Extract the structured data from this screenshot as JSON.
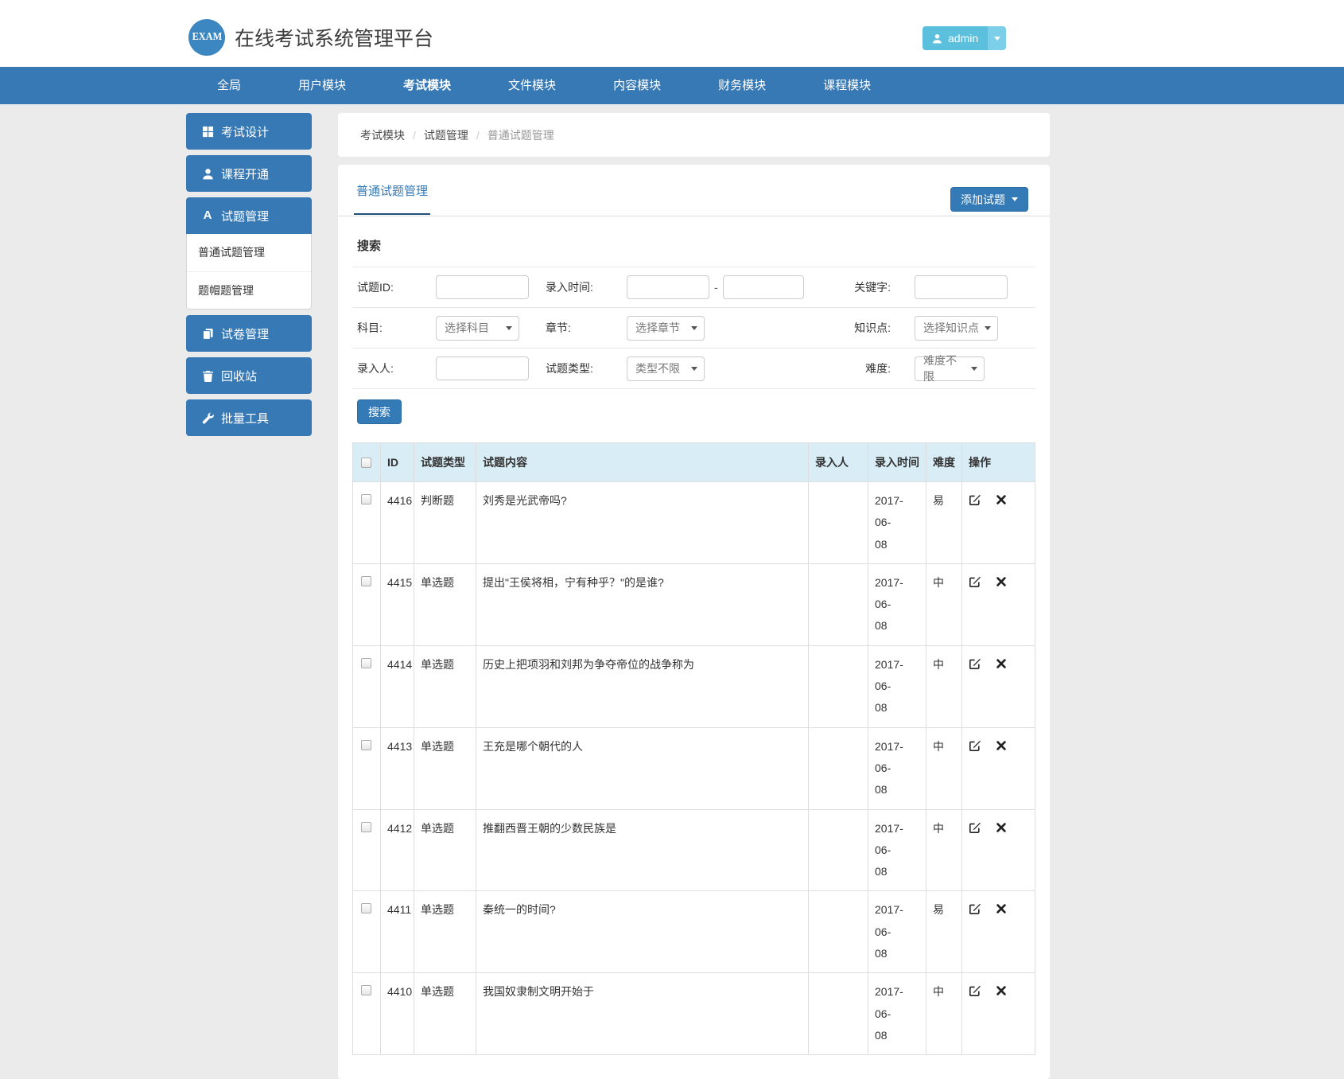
{
  "header": {
    "logo_text": "EXAM",
    "title": "在线考试系统管理平台",
    "user_button": {
      "label": "admin"
    }
  },
  "navbar": {
    "active_index": 2,
    "items": [
      {
        "label": "全局"
      },
      {
        "label": "用户模块"
      },
      {
        "label": "考试模块"
      },
      {
        "label": "文件模块"
      },
      {
        "label": "内容模块"
      },
      {
        "label": "财务模块"
      },
      {
        "label": "课程模块"
      }
    ]
  },
  "sidebar": {
    "items": [
      {
        "label": "考试设计",
        "icon": "grid-icon"
      },
      {
        "label": "课程开通",
        "icon": "user-icon"
      },
      {
        "label": "试题管理",
        "icon": "font-a-icon",
        "icon_glyph": "A",
        "active": true,
        "children": [
          {
            "label": "普通试题管理",
            "active": true
          },
          {
            "label": "题帽题管理",
            "active": false
          }
        ]
      },
      {
        "label": "试卷管理",
        "icon": "files-icon"
      },
      {
        "label": "回收站",
        "icon": "trash-icon"
      },
      {
        "label": "批量工具",
        "icon": "wrench-icon"
      }
    ]
  },
  "breadcrumb": {
    "separator": "/",
    "items": [
      "考试模块",
      "试题管理",
      "普通试题管理"
    ]
  },
  "panel": {
    "active_tab": "普通试题管理",
    "add_button_label": "添加试题",
    "search_heading": "搜索",
    "search_button_label": "搜索"
  },
  "search_form": {
    "row1": {
      "f1_label": "试题ID:",
      "f2_label": "录入时间:",
      "range_separator": "-",
      "f3_label": "关键字:"
    },
    "row2": {
      "f1_label": "科目:",
      "f1_value": "选择科目",
      "f2_label": "章节:",
      "f2_value": "选择章节",
      "f3_label": "知识点:",
      "f3_value": "选择知识点"
    },
    "row3": {
      "f1_label": "录入人:",
      "f2_label": "试题类型:",
      "f2_value": "类型不限",
      "f3_label": "难度:",
      "f3_value": "难度不限"
    }
  },
  "table": {
    "columns": [
      "ID",
      "试题类型",
      "试题内容",
      "录入人",
      "录入时间",
      "难度",
      "操作"
    ],
    "rows": [
      {
        "id": "4416",
        "qtype": "判断题",
        "content": "刘秀是光武帝吗?",
        "author": "",
        "date": "2017-06-08",
        "date_line1": "2017-06-",
        "date_line2": "08",
        "difficulty": "易"
      },
      {
        "id": "4415",
        "qtype": "单选题",
        "content": "提出\"王侯将相，宁有种乎？\"的是谁?",
        "author": "",
        "date": "2017-06-08",
        "date_line1": "2017-06-",
        "date_line2": "08",
        "difficulty": "中"
      },
      {
        "id": "4414",
        "qtype": "单选题",
        "content": "历史上把项羽和刘邦为争夺帝位的战争称为",
        "author": "",
        "date": "2017-06-08",
        "date_line1": "2017-06-",
        "date_line2": "08",
        "difficulty": "中"
      },
      {
        "id": "4413",
        "qtype": "单选题",
        "content": "王充是哪个朝代的人",
        "author": "",
        "date": "2017-06-08",
        "date_line1": "2017-06-",
        "date_line2": "08",
        "difficulty": "中"
      },
      {
        "id": "4412",
        "qtype": "单选题",
        "content": "推翻西晋王朝的少数民族是",
        "author": "",
        "date": "2017-06-08",
        "date_line1": "2017-06-",
        "date_line2": "08",
        "difficulty": "中"
      },
      {
        "id": "4411",
        "qtype": "单选题",
        "content": "秦统一的时间?",
        "author": "",
        "date": "2017-06-08",
        "date_line1": "2017-06-",
        "date_line2": "08",
        "difficulty": "易"
      },
      {
        "id": "4410",
        "qtype": "单选题",
        "content": "我国奴隶制文明开始于",
        "author": "",
        "date": "2017-06-08",
        "date_line1": "2017-06-",
        "date_line2": "08",
        "difficulty": "中"
      }
    ]
  },
  "colors": {
    "accent": "#337ab7",
    "navbar": "#3779b5",
    "user_button": "#5bc0de",
    "table_header_bg": "#d9edf7",
    "tab_underline": "#1f4e79",
    "page_bg": "#ebebeb"
  }
}
